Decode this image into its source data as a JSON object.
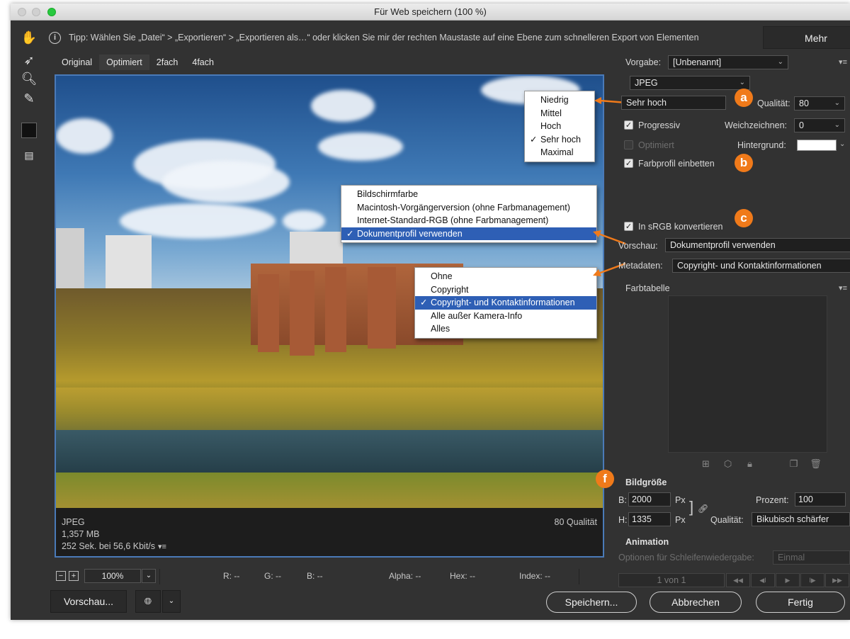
{
  "window": {
    "title": "Für Web speichern (100 %)"
  },
  "tip": {
    "icon": "info-icon",
    "text": "Tipp: Wählen Sie „Datei“ > „Exportieren“ > „Exportieren als…“ oder klicken Sie mir der rechten Maustaste auf eine Ebene zum schnelleren Export von Elementen",
    "more_label": "Mehr"
  },
  "tools": [
    "hand-icon",
    "slice-select-icon",
    "zoom-icon",
    "eyedropper-icon",
    "color-swatch",
    "toggle-slices-icon"
  ],
  "view_tabs": [
    "Original",
    "Optimiert",
    "2fach",
    "4fach"
  ],
  "preview_info": {
    "format": "JPEG",
    "size": "1,357 MB",
    "time": "252 Sek. bei 56,6 Kbit/s",
    "quality": "80 Qualität"
  },
  "quality_menu": {
    "items": [
      "Niedrig",
      "Mittel",
      "Hoch",
      "Sehr hoch",
      "Maximal"
    ],
    "selected": "Sehr hoch"
  },
  "preview_menu": {
    "items": [
      "Bildschirmfarbe",
      "Macintosh-Vorgängerversion (ohne Farbmanagement)",
      "Internet-Standard-RGB (ohne Farbmanagement)",
      "Dokumentprofil verwenden"
    ],
    "selected": "Dokumentprofil verwenden"
  },
  "metadata_menu": {
    "items": [
      "Ohne",
      "Copyright",
      "Copyright- und Kontaktinformationen",
      "Alle außer Kamera-Info",
      "Alles"
    ],
    "selected": "Copyright- und Kontaktinformationen"
  },
  "settings": {
    "preset_label": "Vorgabe:",
    "preset_value": "[Unbenannt]",
    "format_value": "JPEG",
    "quality_preset": "Sehr hoch",
    "quality_label": "Qualität:",
    "quality_value": "80",
    "progressive_label": "Progressiv",
    "blur_label": "Weichzeichnen:",
    "blur_value": "0",
    "optimized_label": "Optimiert",
    "background_label": "Hintergrund:",
    "embed_profile_label": "Farbprofil einbetten",
    "srgb_label": "In sRGB konvertieren",
    "preview_label": "Vorschau:",
    "preview_value": "Dokumentprofil verwenden",
    "metadata_label": "Metadaten:",
    "metadata_value": "Copyright- und Kontaktinformationen",
    "colortable_label": "Farbtabelle",
    "progressive_checked": true,
    "optimized_checked": false,
    "embed_checked": true,
    "srgb_checked": true,
    "background_color": "#ffffff"
  },
  "image_size": {
    "title": "Bildgröße",
    "w_label": "B:",
    "w_value": "2000",
    "h_label": "H:",
    "h_value": "1335",
    "unit": "Px",
    "percent_label": "Prozent:",
    "percent_value": "100",
    "quality_label": "Qualität:",
    "quality_value": "Bikubisch schärfer"
  },
  "animation": {
    "title": "Animation",
    "loop_label": "Optionen für Schleifenwiedergabe:",
    "loop_value": "Einmal",
    "frame_label": "1 von 1"
  },
  "badges": [
    "a",
    "b",
    "c",
    "f"
  ],
  "status": {
    "zoom": "100%",
    "r": "R: --",
    "g": "G: --",
    "b": "B: --",
    "alpha": "Alpha: --",
    "hex": "Hex: --",
    "index": "Index: --"
  },
  "buttons": {
    "preview": "Vorschau...",
    "save": "Speichern...",
    "cancel": "Abbrechen",
    "done": "Fertig"
  },
  "colors": {
    "accent": "#f07a1a",
    "selection": "#2e5fb5",
    "preview_border": "#4a7ab8"
  }
}
